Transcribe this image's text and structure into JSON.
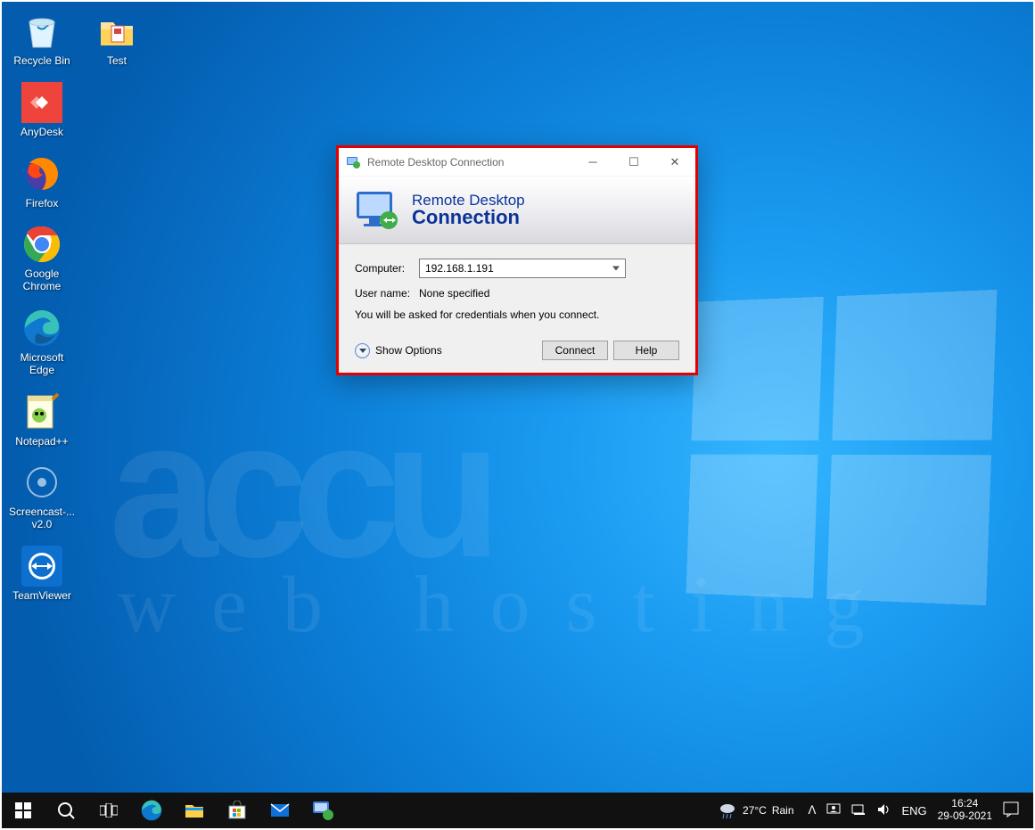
{
  "desktop_icons_col1": [
    {
      "key": "recycle-bin",
      "label": "Recycle Bin"
    },
    {
      "key": "anydesk",
      "label": "AnyDesk"
    },
    {
      "key": "firefox",
      "label": "Firefox"
    },
    {
      "key": "chrome",
      "label": "Google Chrome"
    },
    {
      "key": "edge",
      "label": "Microsoft Edge"
    },
    {
      "key": "notepadpp",
      "label": "Notepad++"
    },
    {
      "key": "screencast",
      "label": "Screencast-... v2.0"
    },
    {
      "key": "teamviewer",
      "label": "TeamViewer"
    }
  ],
  "desktop_icons_col2": [
    {
      "key": "test",
      "label": "Test"
    }
  ],
  "rdc": {
    "title": "Remote Desktop Connection",
    "banner_l1": "Remote Desktop",
    "banner_l2": "Connection",
    "computer_label": "Computer:",
    "computer_value": "192.168.1.191",
    "username_label": "User name:",
    "username_value": "None specified",
    "hint": "You will be asked for credentials when you connect.",
    "show_options": "Show Options",
    "connect": "Connect",
    "help": "Help"
  },
  "taskbar": {
    "weather_temp": "27°C",
    "weather_cond": "Rain",
    "lang": "ENG",
    "time": "16:24",
    "date": "29-09-2021"
  },
  "watermark": {
    "l1": "accu",
    "l2": "web hosting"
  }
}
